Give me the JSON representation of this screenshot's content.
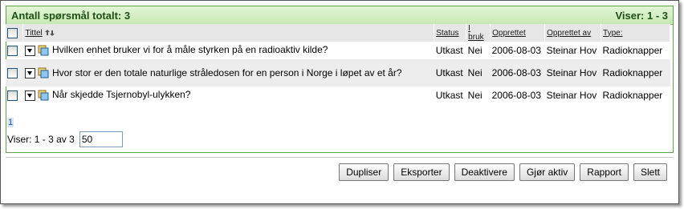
{
  "header": {
    "title": "Antall spørsmål totalt: 3",
    "range": "Viser: 1 - 3"
  },
  "columns": {
    "title": "Tittel",
    "status": "Status",
    "in_use": "I bruk",
    "created": "Opprettet",
    "created_by": "Opprettet av",
    "type": "Type:"
  },
  "rows": [
    {
      "title": "Hvilken enhet bruker vi for å måle styrken på en radioaktiv kilde?",
      "status": "Utkast",
      "in_use": "Nei",
      "created": "2006-08-03",
      "created_by": "Steinar Hov",
      "type": "Radioknapper"
    },
    {
      "title": "Hvor stor er den totale naturlige stråledosen for en person i Norge i løpet av et år?",
      "status": "Utkast",
      "in_use": "Nei",
      "created": "2006-08-03",
      "created_by": "Steinar Hov",
      "type": "Radioknapper"
    },
    {
      "title": "Når skjedde Tsjernobyl-ulykken?",
      "status": "Utkast",
      "in_use": "Nei",
      "created": "2006-08-03",
      "created_by": "Steinar Hov",
      "type": "Radioknapper"
    }
  ],
  "pager": {
    "page": "1",
    "summary": "Viser: 1 - 3 av 3",
    "page_size": "50"
  },
  "buttons": {
    "duplicate": "Dupliser",
    "export": "Eksporter",
    "deactivate": "Deaktivere",
    "activate": "Gjør aktiv",
    "report": "Rapport",
    "delete": "Slett"
  },
  "colors": {
    "header_green": "#c6e8b3",
    "border_green": "#5ea24a",
    "header_text": "#1f4f15"
  },
  "icons": {
    "sort": "sort-arrows-icon",
    "question": "question-stack-icon",
    "dropdown": "dropdown-arrow-icon"
  }
}
